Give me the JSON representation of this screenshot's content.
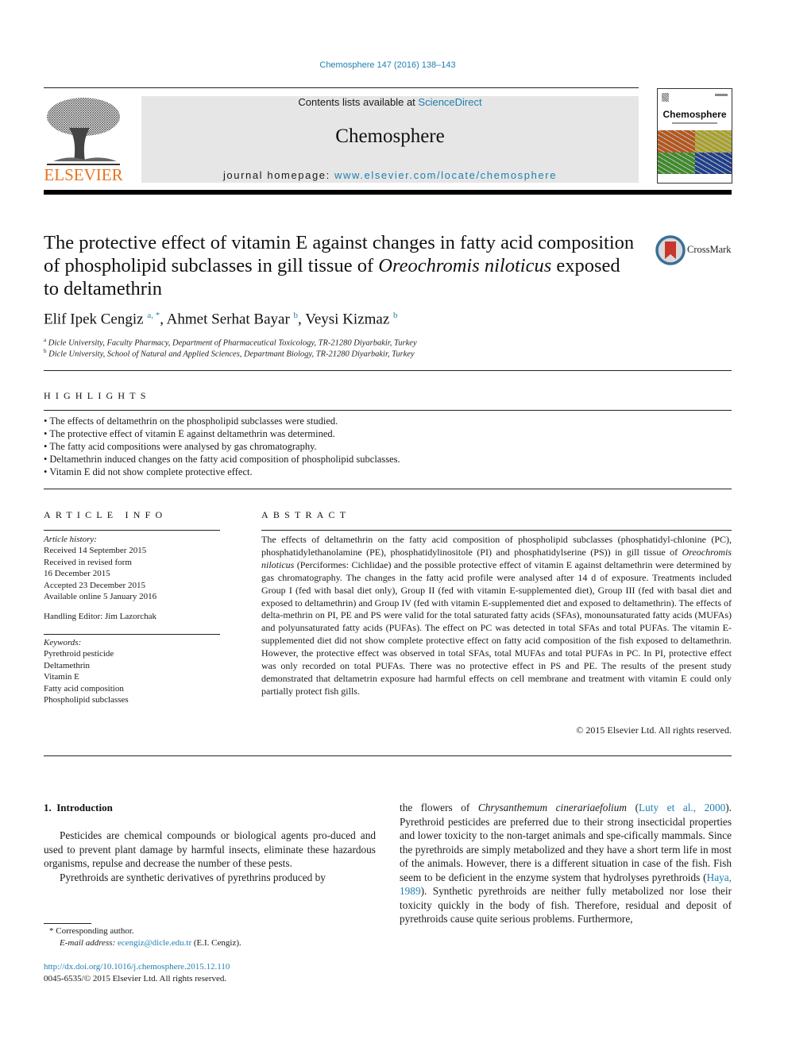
{
  "header": {
    "citation": "Chemosphere 147 (2016) 138–143",
    "contents_prefix": "Contents lists available at ",
    "contents_link": "ScienceDirect",
    "journal_title": "Chemosphere",
    "homepage_prefix": "journal homepage: ",
    "homepage_link": "www.elsevier.com/locate/chemosphere",
    "publisher_logo_text": "ELSEVIER",
    "cover_title": "Chemosphere",
    "cover_colors": [
      "#b5561c",
      "#a9a12a",
      "#3f8a2a",
      "#1f3f8a"
    ],
    "publisher_color": "#e8731c",
    "link_color": "#1f7fb0"
  },
  "article": {
    "title_part1": "The protective effect of vitamin E against changes in fatty acid composition of phospholipid subclasses in gill tissue of ",
    "title_italic": "Oreochromis niloticus",
    "title_part2": " exposed to deltamethrin",
    "crossmark_label": "CrossMark",
    "authors": [
      {
        "name": "Elif Ipek Cengiz",
        "sup": "a, *"
      },
      {
        "name": "Ahmet Serhat Bayar",
        "sup": "b"
      },
      {
        "name": "Veysi Kizmaz",
        "sup": "b"
      }
    ],
    "affiliations": [
      {
        "sup": "a",
        "text": "Dicle University, Faculty Pharmacy, Department of Pharmaceutical Toxicology, TR-21280 Diyarbakir, Turkey"
      },
      {
        "sup": "b",
        "text": "Dicle University, School of Natural and Applied Sciences, Departmant Biology, TR-21280 Diyarbakir, Turkey"
      }
    ]
  },
  "highlights": {
    "heading": "HIGHLIGHTS",
    "items": [
      "The effects of deltamethrin on the phospholipid subclasses were studied.",
      "The protective effect of vitamin E against deltamethrin was determined.",
      "The fatty acid compositions were analysed by gas chromatography.",
      "Deltamethrin induced changes on the fatty acid composition of phospholipid subclasses.",
      "Vitamin E did not show complete protective effect."
    ]
  },
  "article_info": {
    "heading": "ARTICLE INFO",
    "history_label": "Article history:",
    "history": [
      "Received 14 September 2015",
      "Received in revised form",
      "16 December 2015",
      "Accepted 23 December 2015",
      "Available online 5 January 2016"
    ],
    "handling_editor": "Handling Editor: Jim Lazorchak",
    "keywords_label": "Keywords:",
    "keywords": [
      "Pyrethroid pesticide",
      "Deltamethrin",
      "Vitamin E",
      "Fatty acid composition",
      "Phospholipid subclasses"
    ]
  },
  "abstract": {
    "heading": "ABSTRACT",
    "text_part1": "The effects of deltamethrin on the fatty acid composition of phospholipid subclasses (phosphatidyl-chlonine (PC), phosphatidylethanolamine (PE), phosphatidylinositole (PI) and phosphatidylserine (PS)) in gill tissue of ",
    "text_italic": "Oreochromis niloticus",
    "text_part2": " (Perciformes: Cichlidae) and the possible protective effect of vitamin E against deltamethrin were determined by gas chromatography. The changes in the fatty acid profile were analysed after 14 d of exposure. Treatments included Group I (fed with basal diet only), Group II (fed with vitamin E-supplemented diet), Group III (fed with basal diet and exposed to deltamethrin) and Group IV (fed with vitamin E-supplemented diet and exposed to deltamethrin). The effects of delta-methrin on PI, PE and PS were valid for the total saturated fatty acids (SFAs), monounsaturated fatty acids (MUFAs) and polyunsaturated fatty acids (PUFAs). The effect on PC was detected in total SFAs and total PUFAs. The vitamin E-supplemented diet did not show complete protective effect on fatty acid composition of the fish exposed to deltamethrin. However, the protective effect was observed in total SFAs, total MUFAs and total PUFAs in PC. In PI, protective effect was only recorded on total PUFAs. There was no protective effect in PS and PE. The results of the present study demonstrated that deltametrin exposure had harmful effects on cell membrane and treatment with vitamin E could only partially protect fish gills.",
    "copyright": "© 2015 Elsevier Ltd. All rights reserved."
  },
  "introduction": {
    "heading": "1.  Introduction",
    "para1": "Pesticides are chemical compounds or biological agents pro-duced and used to prevent plant damage by harmful insects, eliminate these hazardous organisms, repulse and decrease the number of these pests.",
    "para2": "Pyrethroids are synthetic derivatives of pyrethrins produced by",
    "col2_part1": "the flowers of ",
    "col2_italic": "Chrysanthemum cinerariaefolium",
    "col2_part2": " (",
    "col2_ref1": "Luty et al., 2000",
    "col2_part3": "). Pyrethroid pesticides are preferred due to their strong insecticidal properties and lower toxicity to the non-target animals and spe-cifically mammals. Since the pyrethroids are simply metabolized and they have a short term life in most of the animals. However, there is a different situation in case of the fish. Fish seem to be deficient in the enzyme system that hydrolyses pyrethroids (",
    "col2_ref2": "Haya, 1989",
    "col2_part4": "). Synthetic pyrethroids are neither fully metabolized nor lose their toxicity quickly in the body of fish. Therefore, residual and deposit of pyrethroids cause quite serious problems. Furthermore,"
  },
  "footnotes": {
    "corresponding": "* Corresponding author.",
    "email_label": "E-mail address: ",
    "email": "ecengiz@dicle.edu.tr",
    "email_suffix": " (E.I. Cengiz).",
    "doi": "http://dx.doi.org/10.1016/j.chemosphere.2015.12.110",
    "issn_copyright": "0045-6535/© 2015 Elsevier Ltd. All rights reserved."
  }
}
